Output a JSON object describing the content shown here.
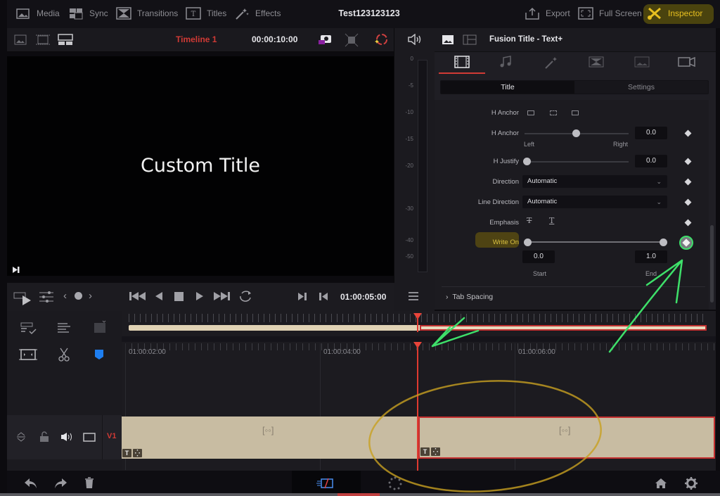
{
  "topbar": {
    "media": "Media",
    "sync": "Sync",
    "transitions": "Transitions",
    "titles": "Titles",
    "effects": "Effects",
    "project_title": "Test123123123",
    "export": "Export",
    "full_screen": "Full Screen",
    "inspector": "Inspector"
  },
  "viewer": {
    "timeline_name": "Timeline 1",
    "duration": "00:00:10:00",
    "preview_text": "Custom Title",
    "current_timecode": "01:00:05:00"
  },
  "meters": {
    "scale": [
      "0",
      "-5",
      "-10",
      "-15",
      "-20",
      "-30",
      "-40",
      "-50"
    ]
  },
  "inspector": {
    "header_title": "Fusion Title - Text+",
    "segments": [
      "Title",
      "Settings"
    ],
    "active_segment": "Title",
    "params": {
      "h_anchor_icons_label": "H Anchor",
      "h_anchor_label": "H Anchor",
      "h_anchor_value": "0.0",
      "h_anchor_left": "Left",
      "h_anchor_right": "Right",
      "h_justify_label": "H Justify",
      "h_justify_value": "0.0",
      "direction_label": "Direction",
      "direction_value": "Automatic",
      "line_direction_label": "Line Direction",
      "line_direction_value": "Automatic",
      "emphasis_label": "Emphasis",
      "write_on_label": "Write On",
      "write_on_start": "0.0",
      "write_on_end": "1.0",
      "start_label": "Start",
      "end_label": "End"
    },
    "collapsed_section": "Tab Spacing"
  },
  "timeline": {
    "timecodes": [
      "01:00:02:00",
      "01:00:04:00",
      "01:00:06:00"
    ],
    "track_label": "V1"
  },
  "colors": {
    "accent_red": "#e03a30",
    "inspector_yellow": "#e8c020",
    "clip_beige": "#c8bca2",
    "annotation_green": "#3ee06a"
  }
}
